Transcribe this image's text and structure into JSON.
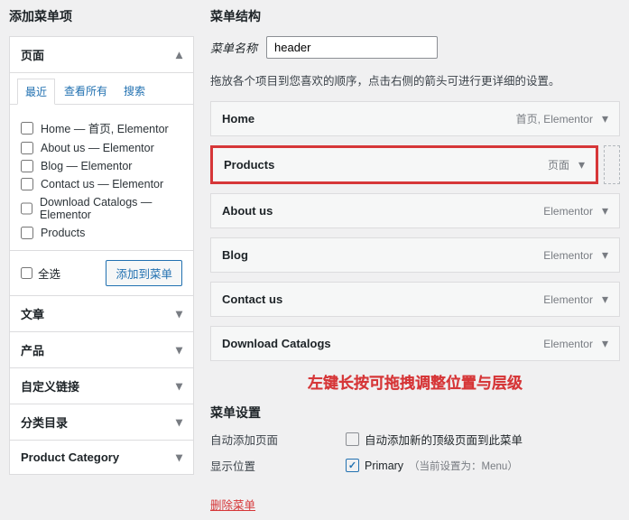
{
  "left": {
    "title": "添加菜单项",
    "sections": {
      "pages": "页面",
      "posts": "文章",
      "products": "产品",
      "custom": "自定义链接",
      "cats": "分类目录",
      "prodcat": "Product Category"
    },
    "tabs": {
      "recent": "最近",
      "all": "查看所有",
      "search": "搜索"
    },
    "items": [
      "Home — 首页, Elementor",
      "About us — Elementor",
      "Blog — Elementor",
      "Contact us — Elementor",
      "Download Catalogs — Elementor",
      "Products"
    ],
    "selectAll": "全选",
    "addBtn": "添加到菜单"
  },
  "right": {
    "title": "菜单结构",
    "nameLabel": "菜单名称",
    "nameValue": "header",
    "hint": "拖放各个项目到您喜欢的顺序，点击右侧的箭头可进行更详细的设置。",
    "items": [
      {
        "title": "Home",
        "sub": "首页, Elementor",
        "indent": false,
        "hl": false
      },
      {
        "title": "Products",
        "sub": "页面",
        "indent": true,
        "hl": true
      },
      {
        "title": "About us",
        "sub": "Elementor",
        "indent": false,
        "hl": false
      },
      {
        "title": "Blog",
        "sub": "Elementor",
        "indent": false,
        "hl": false
      },
      {
        "title": "Contact us",
        "sub": "Elementor",
        "indent": false,
        "hl": false
      },
      {
        "title": "Download Catalogs",
        "sub": "Elementor",
        "indent": false,
        "hl": false
      }
    ],
    "annotation": "左键长按可拖拽调整位置与层级",
    "settings": {
      "heading": "菜单设置",
      "autoAddLabel": "自动添加页面",
      "autoAddText": "自动添加新的顶级页面到此菜单",
      "locLabel": "显示位置",
      "locPrimary": "Primary",
      "locNote": "（当前设置为：Menu）"
    },
    "delete": "删除菜单"
  }
}
